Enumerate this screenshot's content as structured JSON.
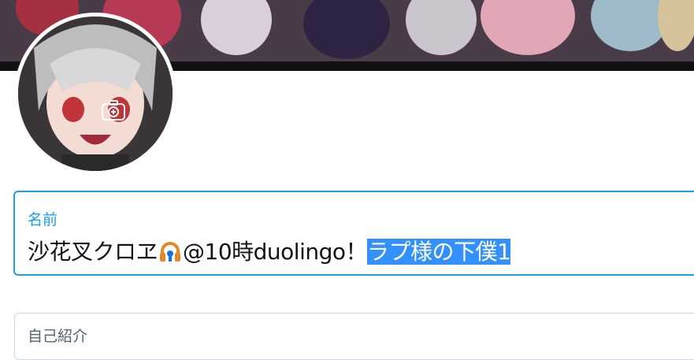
{
  "profile": {
    "banner": {
      "colors": {
        "base": "#3b2f3a",
        "strip": "#111111"
      }
    },
    "avatar": {
      "icon": "avatar-image",
      "camera_icon": "camera-plus-icon"
    }
  },
  "form": {
    "name": {
      "label": "名前",
      "value_plain": "沙花叉クロヱ",
      "emoji": "headphones-keyhole-emoji",
      "value_after_emoji": "@10時duolingo！",
      "value_selected": "ラプ様の下僕1",
      "accent": "#1d9bf0"
    },
    "bio": {
      "label": "自己紹介"
    }
  }
}
